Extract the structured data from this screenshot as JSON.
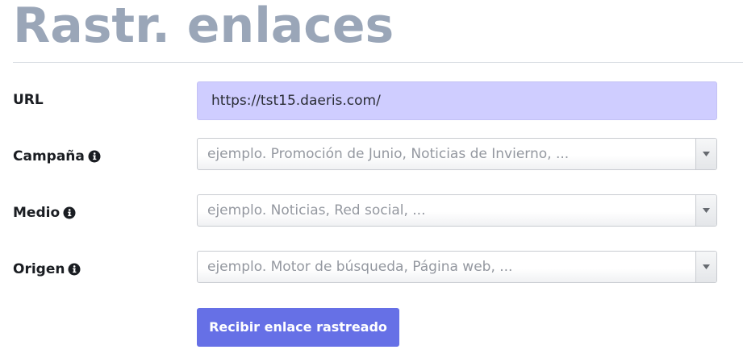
{
  "page": {
    "title": "Rastr. enlaces"
  },
  "form": {
    "url": {
      "label": "URL",
      "value": "https://tst15.daeris.com/"
    },
    "campaign": {
      "label": "Campaña",
      "placeholder": "ejemplo. Promoción de Junio, Noticias de Invierno, ..."
    },
    "medium": {
      "label": "Medio",
      "placeholder": "ejemplo. Noticias, Red social, ..."
    },
    "source": {
      "label": "Origen",
      "placeholder": "ejemplo. Motor de búsqueda, Página web, ..."
    },
    "submit_label": "Recibir enlace rastreado"
  },
  "icons": {
    "info": "info-circle-icon",
    "dropdown": "triangle-down-icon"
  },
  "colors": {
    "title": "#9aa6b8",
    "url_field_bg": "#cfcdff",
    "button_bg": "#6670e6",
    "placeholder": "#9498a0"
  }
}
